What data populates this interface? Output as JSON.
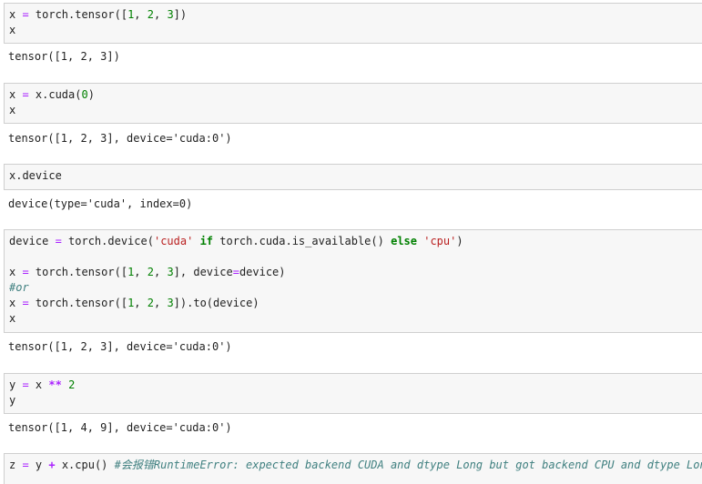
{
  "cells": [
    {
      "lines": [
        [
          {
            "t": "x ",
            "c": ""
          },
          {
            "t": "=",
            "c": "eq"
          },
          {
            "t": " torch.tensor([",
            "c": ""
          },
          {
            "t": "1",
            "c": "num"
          },
          {
            "t": ", ",
            "c": ""
          },
          {
            "t": "2",
            "c": "num"
          },
          {
            "t": ", ",
            "c": ""
          },
          {
            "t": "3",
            "c": "num"
          },
          {
            "t": "])",
            "c": ""
          }
        ],
        [
          {
            "t": "x",
            "c": ""
          }
        ]
      ],
      "output": [
        "tensor([1, 2, 3])"
      ]
    },
    {
      "lines": [
        [
          {
            "t": "x ",
            "c": ""
          },
          {
            "t": "=",
            "c": "eq"
          },
          {
            "t": " x.cuda(",
            "c": ""
          },
          {
            "t": "0",
            "c": "num"
          },
          {
            "t": ")",
            "c": ""
          }
        ],
        [
          {
            "t": "x",
            "c": ""
          }
        ]
      ],
      "output": [
        "tensor([1, 2, 3], device='cuda:0')"
      ]
    },
    {
      "lines": [
        [
          {
            "t": "x.device",
            "c": ""
          }
        ]
      ],
      "output": [
        "device(type='cuda', index=0)"
      ]
    },
    {
      "lines": [
        [
          {
            "t": "device ",
            "c": ""
          },
          {
            "t": "=",
            "c": "eq"
          },
          {
            "t": " torch.device(",
            "c": ""
          },
          {
            "t": "'cuda'",
            "c": "str"
          },
          {
            "t": " ",
            "c": ""
          },
          {
            "t": "if",
            "c": "kw"
          },
          {
            "t": " torch.cuda.is_available() ",
            "c": ""
          },
          {
            "t": "else",
            "c": "kw"
          },
          {
            "t": " ",
            "c": ""
          },
          {
            "t": "'cpu'",
            "c": "str"
          },
          {
            "t": ")",
            "c": ""
          }
        ],
        [],
        [
          {
            "t": "x ",
            "c": ""
          },
          {
            "t": "=",
            "c": "eq"
          },
          {
            "t": " torch.tensor([",
            "c": ""
          },
          {
            "t": "1",
            "c": "num"
          },
          {
            "t": ", ",
            "c": ""
          },
          {
            "t": "2",
            "c": "num"
          },
          {
            "t": ", ",
            "c": ""
          },
          {
            "t": "3",
            "c": "num"
          },
          {
            "t": "], device",
            "c": ""
          },
          {
            "t": "=",
            "c": "eq"
          },
          {
            "t": "device)",
            "c": ""
          }
        ],
        [
          {
            "t": "#or",
            "c": "cmt"
          }
        ],
        [
          {
            "t": "x ",
            "c": ""
          },
          {
            "t": "=",
            "c": "eq"
          },
          {
            "t": " torch.tensor([",
            "c": ""
          },
          {
            "t": "1",
            "c": "num"
          },
          {
            "t": ", ",
            "c": ""
          },
          {
            "t": "2",
            "c": "num"
          },
          {
            "t": ", ",
            "c": ""
          },
          {
            "t": "3",
            "c": "num"
          },
          {
            "t": "]).to(device)",
            "c": ""
          }
        ],
        [
          {
            "t": "x",
            "c": ""
          }
        ]
      ],
      "output": [
        "tensor([1, 2, 3], device='cuda:0')"
      ]
    },
    {
      "lines": [
        [
          {
            "t": "y ",
            "c": ""
          },
          {
            "t": "=",
            "c": "eq"
          },
          {
            "t": " x ",
            "c": ""
          },
          {
            "t": "**",
            "c": "op"
          },
          {
            "t": " ",
            "c": ""
          },
          {
            "t": "2",
            "c": "num"
          }
        ],
        [
          {
            "t": "y",
            "c": ""
          }
        ]
      ],
      "output": [
        "tensor([1, 4, 9], device='cuda:0')"
      ]
    },
    {
      "lines": [
        [
          {
            "t": "z ",
            "c": ""
          },
          {
            "t": "=",
            "c": "eq"
          },
          {
            "t": " y ",
            "c": ""
          },
          {
            "t": "+",
            "c": "op"
          },
          {
            "t": " x.cpu() ",
            "c": ""
          },
          {
            "t": "#会报错RuntimeError: expected backend CUDA and dtype Long but got backend CPU and dtype Long",
            "c": "cmt"
          }
        ]
      ],
      "output": []
    }
  ]
}
